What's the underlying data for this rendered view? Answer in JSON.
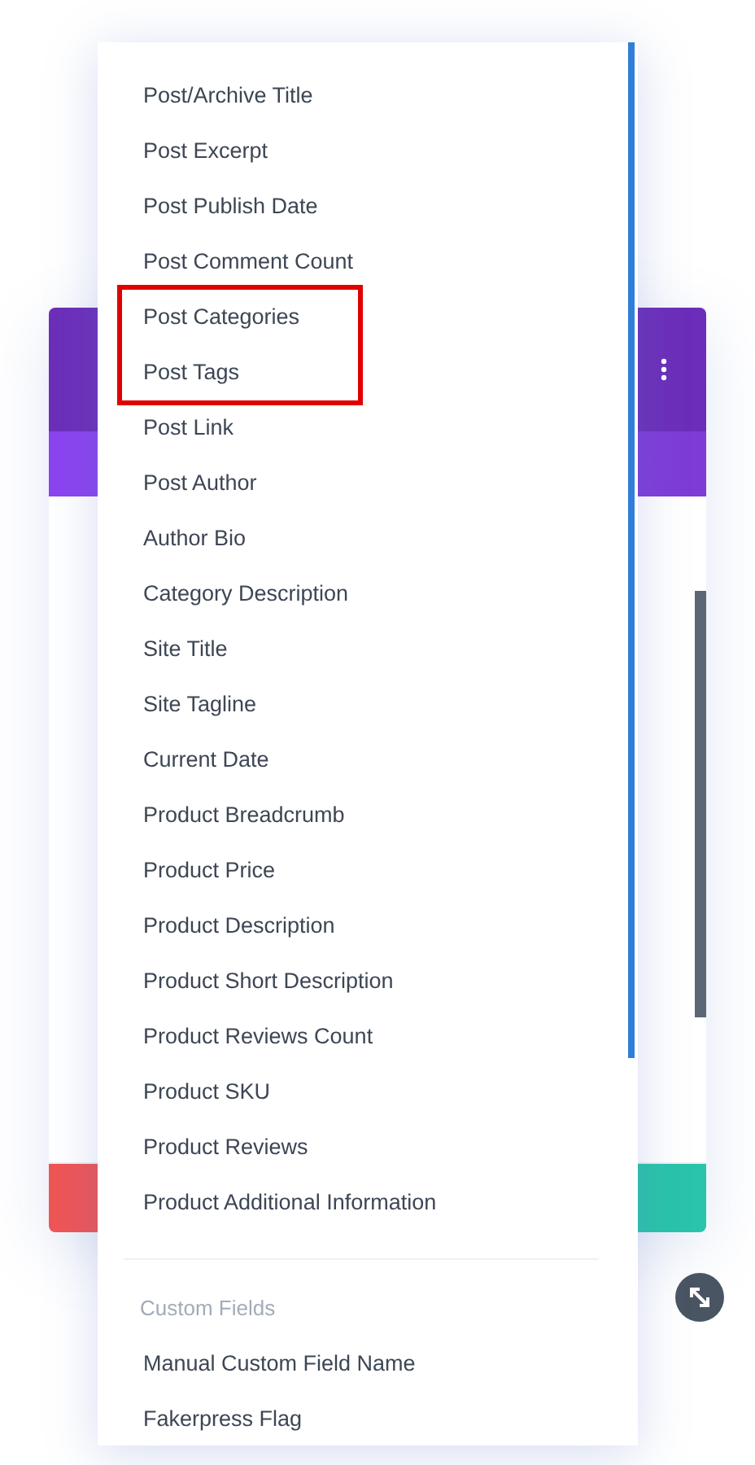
{
  "dropdown": {
    "items": [
      {
        "label": "Post/Archive Title",
        "highlighted": false
      },
      {
        "label": "Post Excerpt",
        "highlighted": false
      },
      {
        "label": "Post Publish Date",
        "highlighted": false
      },
      {
        "label": "Post Comment Count",
        "highlighted": false
      },
      {
        "label": "Post Categories",
        "highlighted": true
      },
      {
        "label": "Post Tags",
        "highlighted": true
      },
      {
        "label": "Post Link",
        "highlighted": false
      },
      {
        "label": "Post Author",
        "highlighted": false
      },
      {
        "label": "Author Bio",
        "highlighted": false
      },
      {
        "label": "Category Description",
        "highlighted": false
      },
      {
        "label": "Site Title",
        "highlighted": false
      },
      {
        "label": "Site Tagline",
        "highlighted": false
      },
      {
        "label": "Current Date",
        "highlighted": false
      },
      {
        "label": "Product Breadcrumb",
        "highlighted": false
      },
      {
        "label": "Product Price",
        "highlighted": false
      },
      {
        "label": "Product Description",
        "highlighted": false
      },
      {
        "label": "Product Short Description",
        "highlighted": false
      },
      {
        "label": "Product Reviews Count",
        "highlighted": false
      },
      {
        "label": "Product SKU",
        "highlighted": false
      },
      {
        "label": "Product Reviews",
        "highlighted": false
      },
      {
        "label": "Product Additional Information",
        "highlighted": false
      }
    ],
    "section": {
      "heading": "Custom Fields",
      "items": [
        {
          "label": "Manual Custom Field Name"
        },
        {
          "label": "Fakerpress Flag"
        }
      ]
    }
  }
}
